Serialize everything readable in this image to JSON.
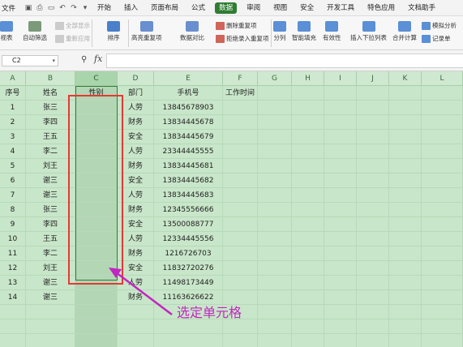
{
  "menubar": {
    "file": "文件",
    "tabs": [
      "开始",
      "插入",
      "页面布局",
      "公式",
      "数据",
      "审阅",
      "视图",
      "安全",
      "开发工具",
      "特色应用",
      "文档助手"
    ],
    "active_tab": "数据"
  },
  "ribbon": {
    "pivot_label": "视表",
    "autofilter_label": "自动筛选",
    "show_all_label": "全部显示",
    "reapply_label": "重新应用",
    "sort_label": "排序",
    "highlight_dup_label": "高亮重复项",
    "data_compare_label": "数据对比",
    "remove_dup_label": "删除重复项",
    "reject_dup_label": "拒绝录入重复项",
    "split_label": "分列",
    "smart_fill_label": "智能填充",
    "validity_label": "有效性",
    "insert_dropdown_label": "插入下拉列表",
    "consolidate_label": "合并计算",
    "simulate_label": "模拟分析",
    "record_label": "记录单"
  },
  "formula_bar": {
    "name_box": "C2",
    "fx": "fx",
    "formula": ""
  },
  "columns": [
    "A",
    "B",
    "C",
    "D",
    "E",
    "F",
    "G",
    "H",
    "I",
    "J",
    "K",
    "L"
  ],
  "selected_column": "C",
  "header_row": [
    "序号",
    "姓名",
    "性别",
    "部门",
    "手机号",
    "工作时间"
  ],
  "rows": [
    [
      "1",
      "张三",
      "",
      "人劳",
      "13845678903",
      ""
    ],
    [
      "2",
      "李四",
      "",
      "财务",
      "13834445678",
      ""
    ],
    [
      "3",
      "王五",
      "",
      "安全",
      "13834445679",
      ""
    ],
    [
      "4",
      "李二",
      "",
      "人劳",
      "23344445555",
      ""
    ],
    [
      "5",
      "刘王",
      "",
      "财务",
      "13834445681",
      ""
    ],
    [
      "6",
      "谢三",
      "",
      "安全",
      "13834445682",
      ""
    ],
    [
      "7",
      "谢三",
      "",
      "人劳",
      "13834445683",
      ""
    ],
    [
      "8",
      "张三",
      "",
      "财务",
      "12345556666",
      ""
    ],
    [
      "9",
      "李四",
      "",
      "安全",
      "13500088777",
      ""
    ],
    [
      "10",
      "王五",
      "",
      "人劳",
      "12334445556",
      ""
    ],
    [
      "11",
      "李二",
      "",
      "财务",
      "1216726703",
      ""
    ],
    [
      "12",
      "刘王",
      "",
      "安全",
      "11832720276",
      ""
    ],
    [
      "13",
      "谢三",
      "",
      "人劳",
      "11498173449",
      ""
    ],
    [
      "14",
      "谢三",
      "",
      "财务",
      "11163626622",
      ""
    ]
  ],
  "annotation": "选定单元格",
  "colors": {
    "accent": "#2e7d32",
    "sheet_bg": "#c8e6c9",
    "highlight_box": "#e53935",
    "annotation": "#c226c2"
  }
}
